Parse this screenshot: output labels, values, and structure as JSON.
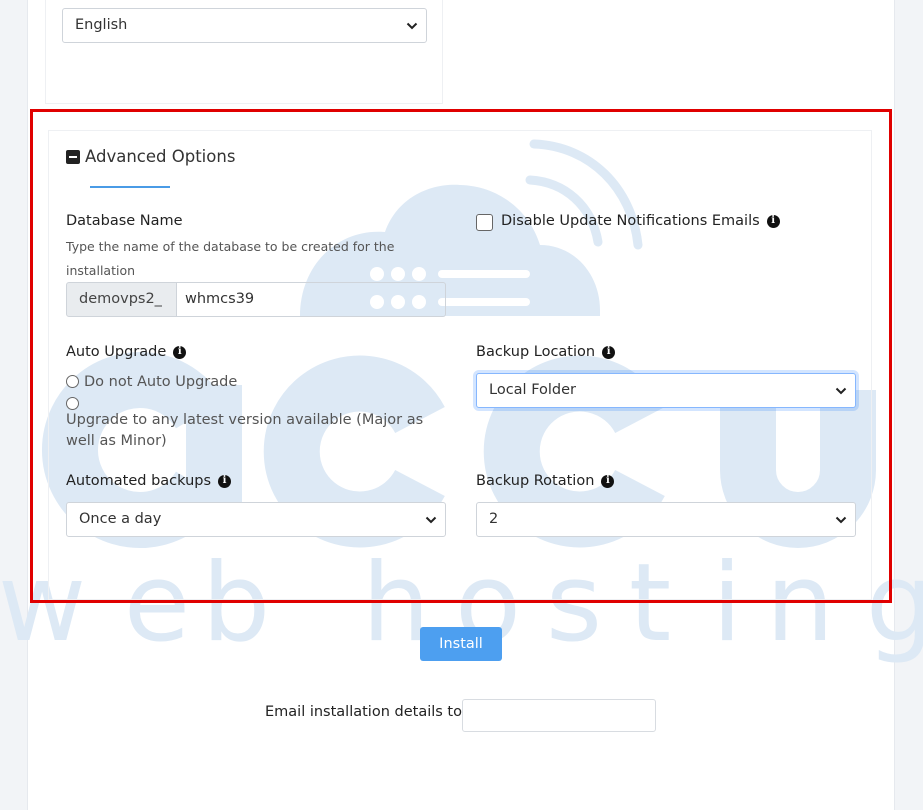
{
  "language_select": {
    "value": "English"
  },
  "advanced_options": {
    "title": "Advanced Options",
    "database_name": {
      "label": "Database Name",
      "help": "Type the name of the database to be created for the installation",
      "prefix": "demovps2_",
      "value": "whmcs39"
    },
    "disable_update_notifications": {
      "label": "Disable Update Notifications Emails",
      "checked": false
    },
    "auto_upgrade": {
      "label": "Auto Upgrade",
      "options": [
        "Do not Auto Upgrade",
        "Upgrade to any latest version available (Major as well as Minor)"
      ]
    },
    "backup_location": {
      "label": "Backup Location",
      "value": "Local Folder"
    },
    "automated_backups": {
      "label": "Automated backups",
      "value": "Once a day"
    },
    "backup_rotation": {
      "label": "Backup Rotation",
      "value": "2"
    }
  },
  "install_button": {
    "label": "Install"
  },
  "email_details": {
    "label": "Email installation details to :",
    "value": ""
  },
  "watermark": {
    "brand": "accu",
    "tagline": "web hosting",
    "color": "#dde9f5"
  },
  "colors": {
    "highlight_frame": "#e00000",
    "accent": "#4d9ff0",
    "underline": "#4a9be6"
  }
}
